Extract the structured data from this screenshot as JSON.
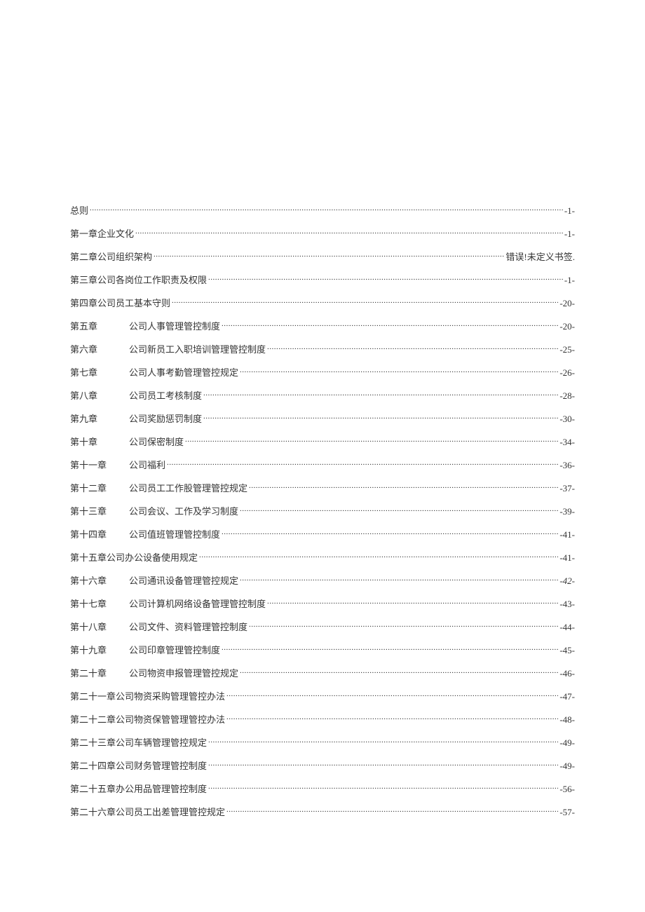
{
  "toc": [
    {
      "style": "a",
      "label": "",
      "title": "总则",
      "page": "-1-"
    },
    {
      "style": "a",
      "label": "",
      "title": "第一章企业文化",
      "page": "-1-"
    },
    {
      "style": "a",
      "label": "",
      "title": "第二章公司组织架构",
      "page": "错误!未定义书签."
    },
    {
      "style": "a",
      "label": "",
      "title": "第三章公司各岗位工作职责及权限",
      "page": "-1-"
    },
    {
      "style": "a",
      "label": "",
      "title": "第四章公司员工基本守则",
      "page": "-20-"
    },
    {
      "style": "b",
      "label": "第五章",
      "title": "公司人事管理管控制度",
      "page": "-20-"
    },
    {
      "style": "b",
      "label": "第六章",
      "title": "公司新员工入职培训管理管控制度",
      "page": "-25-"
    },
    {
      "style": "b",
      "label": "第七章",
      "title": "公司人事考勤管理管控规定",
      "page": "-26-"
    },
    {
      "style": "b",
      "label": "第八章",
      "title": "公司员工考核制度",
      "page": "-28-"
    },
    {
      "style": "b",
      "label": "第九章",
      "title": "公司奖励惩罚制度",
      "page": "-30-"
    },
    {
      "style": "b",
      "label": "第十章",
      "title": "公司保密制度",
      "page": "-34-"
    },
    {
      "style": "b",
      "label": "第十一章",
      "title": "公司福利",
      "page": "-36-"
    },
    {
      "style": "b",
      "label": "第十二章",
      "title": "公司员工工作股管理管控规定",
      "page": "-37-"
    },
    {
      "style": "b",
      "label": "第十三章",
      "title": "公司会议、工作及学习制度",
      "page": "-39-"
    },
    {
      "style": "b",
      "label": "第十四章",
      "title": "公司值班管理管控制度",
      "page": "-41-"
    },
    {
      "style": "a",
      "label": "",
      "title": "第十五章公司办公设备使用规定",
      "page": "-41-"
    },
    {
      "style": "b",
      "label": "第十六章",
      "title": "公司通讯设备管理管控规定",
      "page": "-42-",
      "italic": true
    },
    {
      "style": "b",
      "label": "第十七章",
      "title": "公司计算机网络设备管理管控制度",
      "page": "-43-"
    },
    {
      "style": "b",
      "label": "第十八章",
      "title": "公司文件、资料管理管控制度",
      "page": "-44-"
    },
    {
      "style": "b",
      "label": "第十九章",
      "title": "公司印章管理管控制度",
      "page": "-45-"
    },
    {
      "style": "b",
      "label": "第二十章",
      "title": "公司物资申报管理管控规定",
      "page": "-46-"
    },
    {
      "style": "a",
      "label": "",
      "title": "第二十一章公司物资采购管理管控办法",
      "page": "-47-"
    },
    {
      "style": "a",
      "label": "",
      "title": "第二十二章公司物资保管管理管控办法",
      "page": "-48-"
    },
    {
      "style": "a",
      "label": "",
      "title": "第二十三章公司车辆管理管控规定",
      "page": "-49-"
    },
    {
      "style": "a",
      "label": "",
      "title": "第二十四章公司财务管理管控制度",
      "page": "-49-"
    },
    {
      "style": "a",
      "label": "",
      "title": "第二十五章办公用品管理管控制度",
      "page": "-56-"
    },
    {
      "style": "a",
      "label": "",
      "title": "第二十六章公司员工出差管理管控规定",
      "page": "-57-"
    }
  ]
}
